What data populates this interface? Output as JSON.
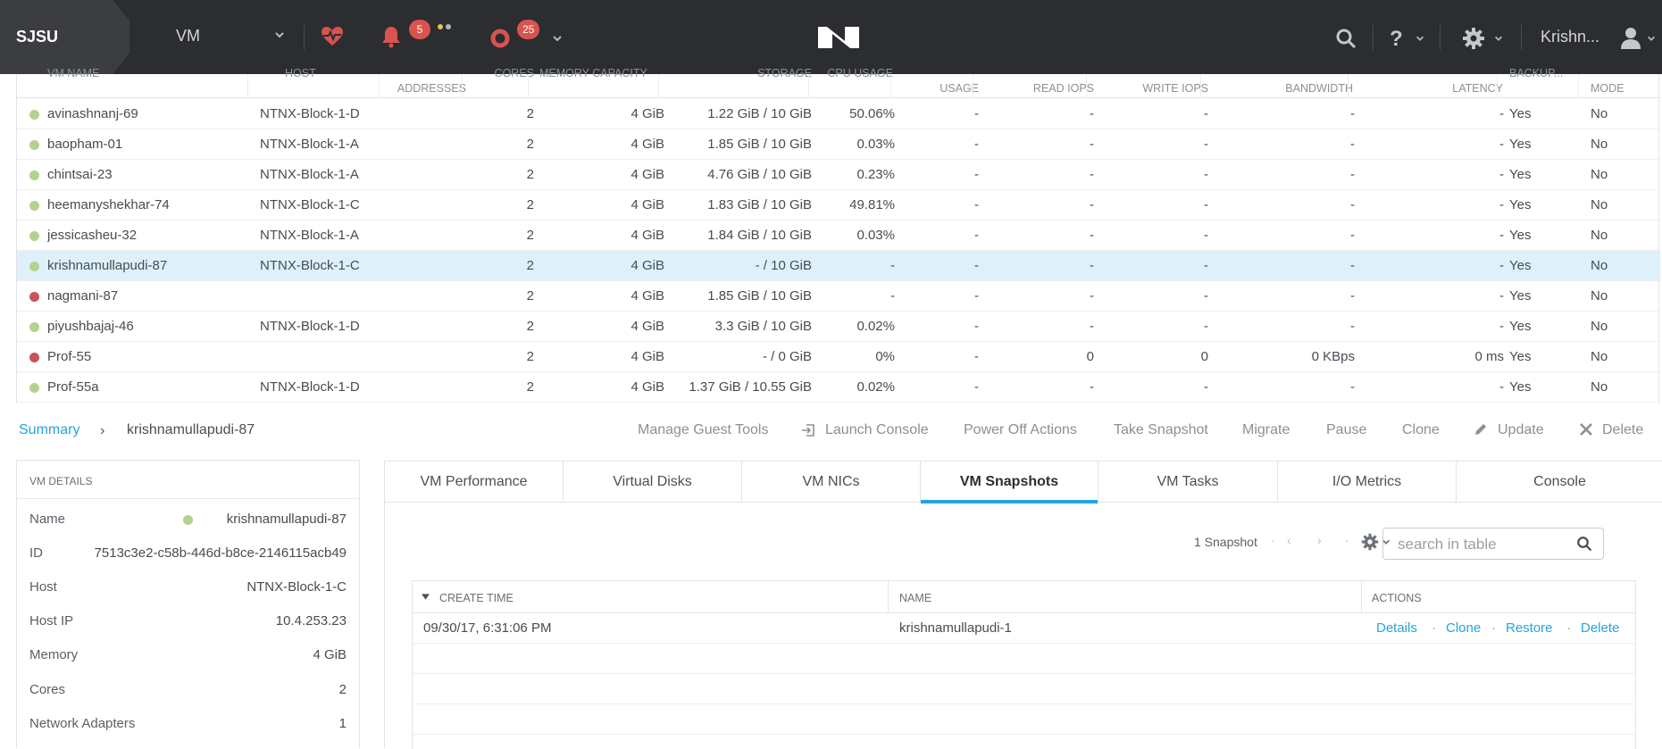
{
  "topbar": {
    "cluster": "SJSU",
    "view": "VM",
    "alert_count": "5",
    "task_count": "25",
    "user": "Krishn..."
  },
  "vm_table": {
    "columns": [
      "VM NAME",
      "HOST",
      "ADDRESSES",
      "CORES",
      "MEMORY CAPACITY",
      "STORAGE",
      "CPU USAGE",
      "USAGE",
      "READ IOPS",
      "WRITE IOPS",
      "BANDWIDTH",
      "LATENCY",
      "BACKUP...",
      "MODE"
    ],
    "rows": [
      {
        "name": "avinashnanj-69",
        "host": "NTNX-Block-1-D",
        "cores": "2",
        "memory": "4 GiB",
        "storage": "1.22 GiB / 10 GiB",
        "cpu": "50.06%",
        "usage": "-",
        "read": "-",
        "write": "-",
        "bw": "-",
        "lat": "-",
        "backup": "Yes",
        "mode": "No",
        "status": "on"
      },
      {
        "name": "baopham-01",
        "host": "NTNX-Block-1-A",
        "cores": "2",
        "memory": "4 GiB",
        "storage": "1.85 GiB / 10 GiB",
        "cpu": "0.03%",
        "usage": "-",
        "read": "-",
        "write": "-",
        "bw": "-",
        "lat": "-",
        "backup": "Yes",
        "mode": "No",
        "status": "on"
      },
      {
        "name": "chintsai-23",
        "host": "NTNX-Block-1-A",
        "cores": "2",
        "memory": "4 GiB",
        "storage": "4.76 GiB / 10 GiB",
        "cpu": "0.23%",
        "usage": "-",
        "read": "-",
        "write": "-",
        "bw": "-",
        "lat": "-",
        "backup": "Yes",
        "mode": "No",
        "status": "on"
      },
      {
        "name": "heemanyshekhar-74",
        "host": "NTNX-Block-1-C",
        "cores": "2",
        "memory": "4 GiB",
        "storage": "1.83 GiB / 10 GiB",
        "cpu": "49.81%",
        "usage": "-",
        "read": "-",
        "write": "-",
        "bw": "-",
        "lat": "-",
        "backup": "Yes",
        "mode": "No",
        "status": "on"
      },
      {
        "name": "jessicasheu-32",
        "host": "NTNX-Block-1-A",
        "cores": "2",
        "memory": "4 GiB",
        "storage": "1.84 GiB / 10 GiB",
        "cpu": "0.03%",
        "usage": "-",
        "read": "-",
        "write": "-",
        "bw": "-",
        "lat": "-",
        "backup": "Yes",
        "mode": "No",
        "status": "on"
      },
      {
        "name": "krishnamullapudi-87",
        "host": "NTNX-Block-1-C",
        "cores": "2",
        "memory": "4 GiB",
        "storage": "- / 10 GiB",
        "cpu": "-",
        "usage": "-",
        "read": "-",
        "write": "-",
        "bw": "-",
        "lat": "-",
        "backup": "Yes",
        "mode": "No",
        "status": "on"
      },
      {
        "name": "nagmani-87",
        "host": "",
        "cores": "2",
        "memory": "4 GiB",
        "storage": "1.85 GiB / 10 GiB",
        "cpu": "-",
        "usage": "-",
        "read": "-",
        "write": "-",
        "bw": "-",
        "lat": "-",
        "backup": "Yes",
        "mode": "No",
        "status": "off"
      },
      {
        "name": "piyushbajaj-46",
        "host": "NTNX-Block-1-D",
        "cores": "2",
        "memory": "4 GiB",
        "storage": "3.3 GiB / 10 GiB",
        "cpu": "0.02%",
        "usage": "-",
        "read": "-",
        "write": "-",
        "bw": "-",
        "lat": "-",
        "backup": "Yes",
        "mode": "No",
        "status": "on"
      },
      {
        "name": "Prof-55",
        "host": "",
        "cores": "2",
        "memory": "4 GiB",
        "storage": "- / 0 GiB",
        "cpu": "0%",
        "usage": "-",
        "read": "0",
        "write": "0",
        "bw": "0 KBps",
        "lat": "0 ms",
        "backup": "Yes",
        "mode": "No",
        "status": "off"
      },
      {
        "name": "Prof-55a",
        "host": "NTNX-Block-1-D",
        "cores": "2",
        "memory": "4 GiB",
        "storage": "1.37 GiB / 10.55 GiB",
        "cpu": "0.02%",
        "usage": "-",
        "read": "-",
        "write": "-",
        "bw": "-",
        "lat": "-",
        "backup": "Yes",
        "mode": "No",
        "status": "on"
      }
    ],
    "selected_index": 5
  },
  "breadcrumb": {
    "summary": "Summary",
    "separator": "›",
    "current": "krishnamullapudi-87"
  },
  "actions": {
    "manage_guest_tools": "Manage Guest Tools",
    "launch_console": "Launch Console",
    "power_off": "Power Off Actions",
    "take_snapshot": "Take Snapshot",
    "migrate": "Migrate",
    "pause": "Pause",
    "clone": "Clone",
    "update": "Update",
    "delete": "Delete"
  },
  "details": {
    "title": "VM DETAILS",
    "name_label": "Name",
    "name": "krishnamullapudi-87",
    "id_label": "ID",
    "id": "7513c3e2-c58b-446d-b8ce-2146115acb49",
    "host_label": "Host",
    "host": "NTNX-Block-1-C",
    "host_ip_label": "Host IP",
    "host_ip": "10.4.253.23",
    "memory_label": "Memory",
    "memory": "4 GiB",
    "cores_label": "Cores",
    "cores": "2",
    "adapters_label": "Network Adapters",
    "adapters": "1"
  },
  "tabs": [
    "VM Performance",
    "Virtual Disks",
    "VM NICs",
    "VM Snapshots",
    "VM Tasks",
    "I/O Metrics",
    "Console"
  ],
  "active_tab": 3,
  "snapshots": {
    "count_label": "1 Snapshot",
    "search_placeholder": "search in table",
    "columns": [
      "CREATE TIME",
      "NAME",
      "ACTIONS"
    ],
    "rows": [
      {
        "time": "09/30/17, 6:31:06 PM",
        "name": "krishnamullapudi-1",
        "details": "Details",
        "clone": "Clone",
        "restore": "Restore",
        "delete": "Delete"
      }
    ]
  },
  "colors": {
    "accent": "#22a5dd",
    "status_on": "#b5d18f",
    "status_off": "#c9535a",
    "badge": "#d9534f",
    "selected_row": "#def1fb"
  }
}
